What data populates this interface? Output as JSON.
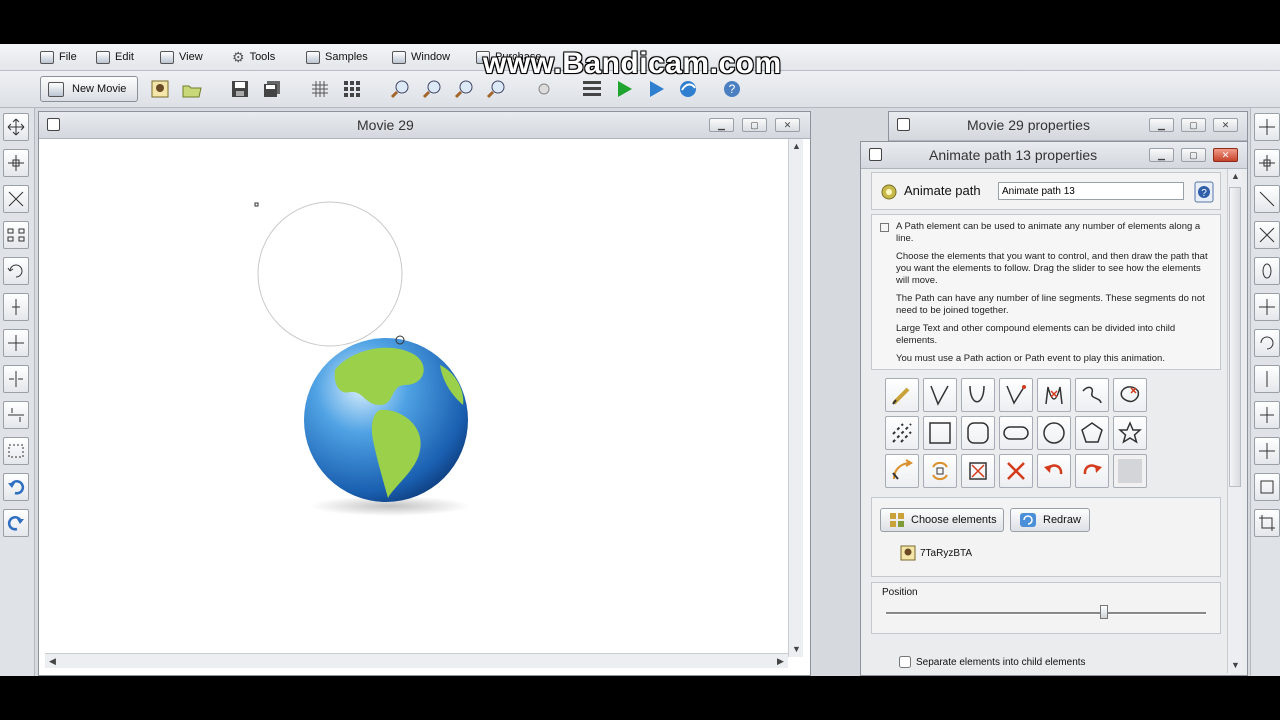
{
  "menu": [
    {
      "label": "File",
      "icon": "save-icon"
    },
    {
      "label": "Edit",
      "icon": "clipboard-icon"
    },
    {
      "label": "View",
      "icon": "view-icon"
    },
    {
      "label": "Tools",
      "icon": "gear-icon"
    },
    {
      "label": "Samples",
      "icon": "samples-icon"
    },
    {
      "label": "Window",
      "icon": "window-icon"
    },
    {
      "label": "Purchase",
      "icon": "cart-icon"
    }
  ],
  "toolbar": {
    "new_movie_label": "New Movie"
  },
  "movie_window": {
    "title": "Movie 29"
  },
  "properties_window": {
    "title": "Movie 29 properties"
  },
  "animate_panel": {
    "title": "Animate path 13 properties",
    "element_type_label": "Animate path",
    "name_value": "Animate path 13",
    "help": [
      "A Path element can be used to animate any number of elements along a line.",
      "Choose the elements that you want to control, and then draw the path that you want the elements to follow. Drag the slider to see how the elements will move.",
      "The Path can have any number of line segments. These segments do not need to be joined together.",
      "Large Text and other compound elements can be divided into child elements.",
      "You must use a Path action or Path event to play this animation."
    ],
    "choose_elements_label": "Choose elements",
    "redraw_label": "Redraw",
    "element_name": "7TaRyzBTA",
    "position_label": "Position",
    "position_value": 0.68,
    "separate_label": "Separate elements into child elements",
    "separate_checked": false
  },
  "watermark": "www.Bandicam.com",
  "colors": {
    "accent_red": "#d43b1c",
    "play_green": "#1fa52f",
    "earth_blue": "#2f7fd0",
    "earth_green": "#9ad04a"
  }
}
